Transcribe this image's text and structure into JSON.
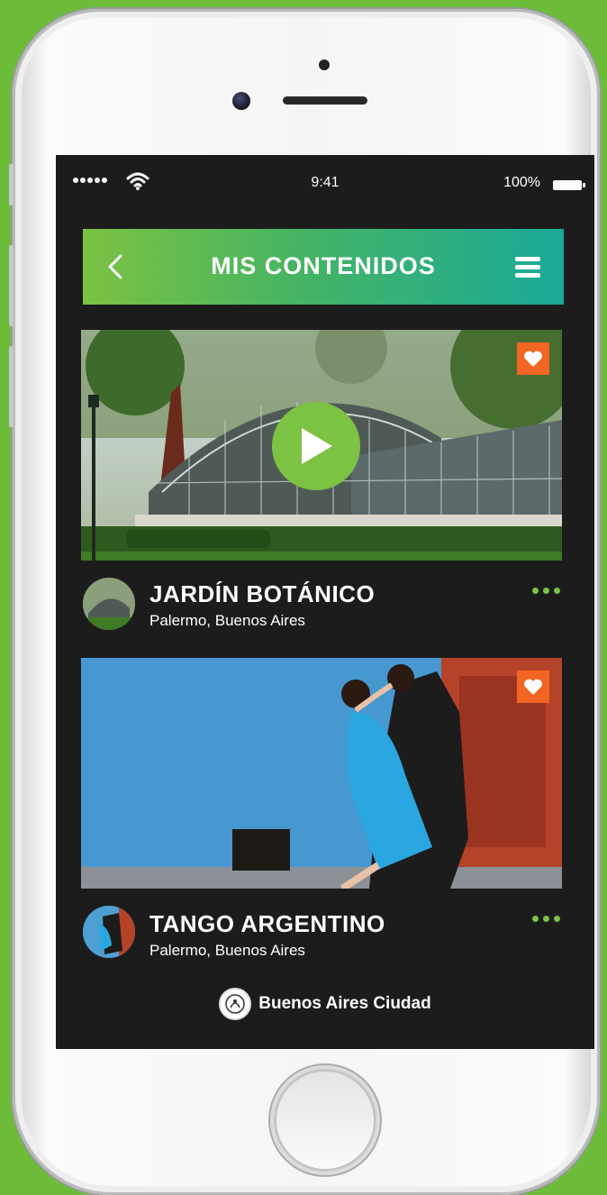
{
  "status_bar": {
    "time": "9:41",
    "battery": "100%"
  },
  "header": {
    "title": "MIS CONTENIDOS"
  },
  "cards": [
    {
      "title": "JARDÍN BOTÁNICO",
      "subtitle": "Palermo, Buenos Aires",
      "has_play": true
    },
    {
      "title": "TANGO ARGENTINO",
      "subtitle": "Palermo, Buenos Aires",
      "has_play": false
    }
  ],
  "footer": {
    "brand": "Buenos Aires Ciudad"
  },
  "colors": {
    "accent_green": "#7cc243",
    "gradient_end": "#1aa99a",
    "favorite": "#f26522",
    "background": "#1c1c1c"
  },
  "icons": [
    "back-icon",
    "menu-icon",
    "heart-icon",
    "play-icon",
    "more-icon",
    "city-seal-icon",
    "wifi-icon"
  ]
}
